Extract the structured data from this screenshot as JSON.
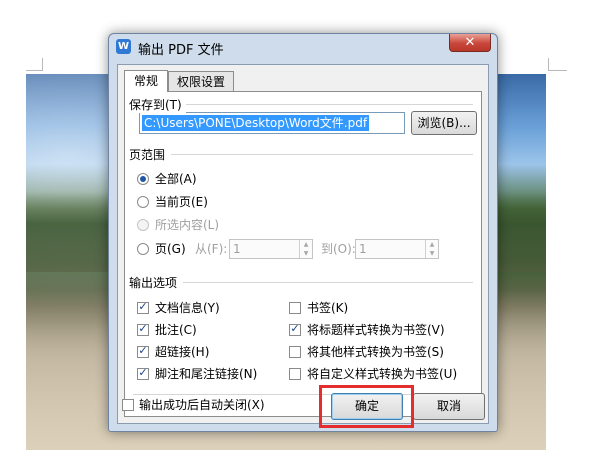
{
  "dialog": {
    "title": "输出 PDF 文件",
    "icon_letter": "W",
    "close_symbol": "✕"
  },
  "tabs": [
    {
      "label": "常规",
      "active": true
    },
    {
      "label": "权限设置",
      "active": false
    }
  ],
  "save_to": {
    "label": "保存到(T)",
    "path": "C:\\Users\\PONE\\Desktop\\Word文件.pdf",
    "browse_label": "浏览(B)..."
  },
  "page_range": {
    "label": "页范围",
    "options": [
      {
        "label": "全部(A)",
        "selected": true,
        "enabled": true
      },
      {
        "label": "当前页(E)",
        "selected": false,
        "enabled": true
      },
      {
        "label": "所选内容(L)",
        "selected": false,
        "enabled": false
      },
      {
        "label": "页(G)",
        "selected": false,
        "enabled": true
      }
    ],
    "from_label": "从(F):",
    "from_value": "1",
    "to_label": "到(O):",
    "to_value": "1"
  },
  "output_options": {
    "label": "输出选项",
    "left": [
      {
        "label": "文档信息(Y)",
        "checked": true
      },
      {
        "label": "批注(C)",
        "checked": true
      },
      {
        "label": "超链接(H)",
        "checked": true
      },
      {
        "label": "脚注和尾注链接(N)",
        "checked": true
      }
    ],
    "right": [
      {
        "label": "书签(K)",
        "checked": false
      },
      {
        "label": "将标题样式转换为书签(V)",
        "checked": true
      },
      {
        "label": "将其他样式转换为书签(S)",
        "checked": false
      },
      {
        "label": "将自定义样式转换为书签(U)",
        "checked": false
      }
    ]
  },
  "footer": {
    "auto_close_label": "输出成功后自动关闭(X)",
    "auto_close_checked": false,
    "ok_label": "确定",
    "cancel_label": "取消"
  },
  "colors": {
    "selection": "#3399ff",
    "annotation_box": "#e52d2d",
    "close_button": "#c9463a"
  }
}
